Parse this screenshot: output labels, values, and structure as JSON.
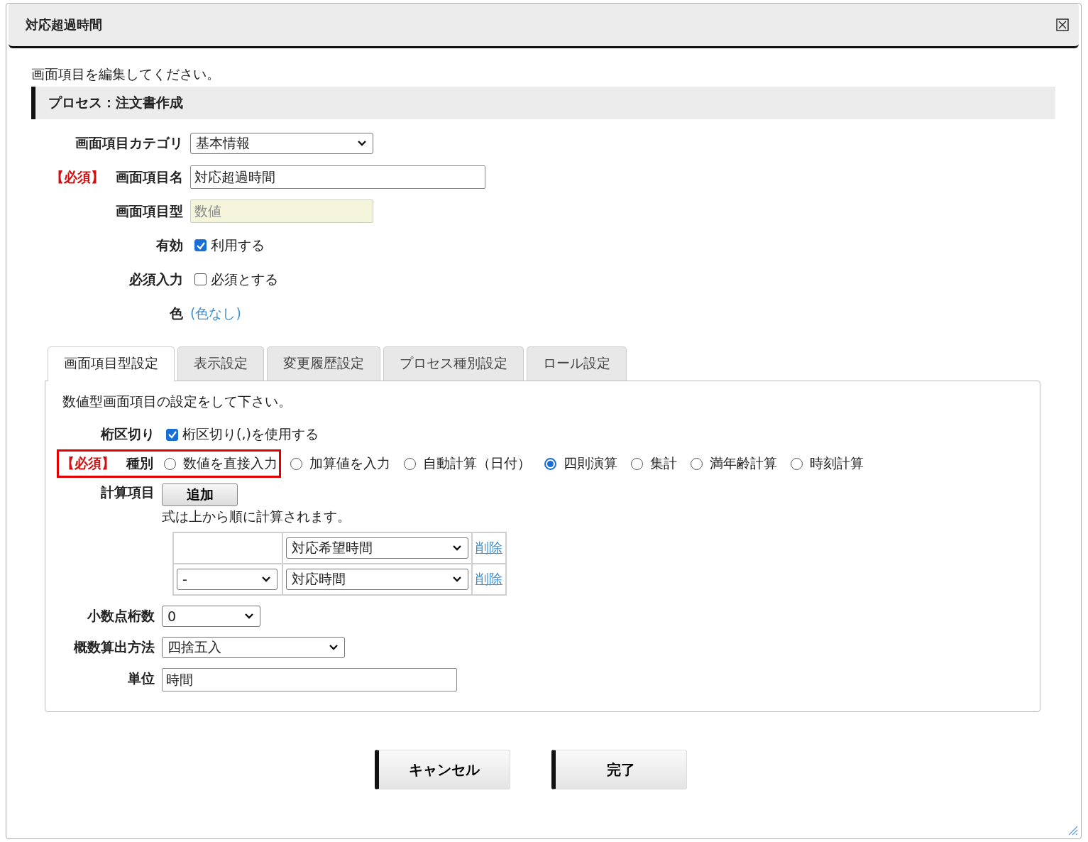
{
  "dialog": {
    "title": "対応超過時間"
  },
  "intro": "画面項目を編集してください。",
  "section": "プロセス：注文書作成",
  "fields": [
    {
      "kind": "select",
      "label": "画面項目カテゴリ",
      "value": "基本情報"
    },
    {
      "kind": "text",
      "label": "画面項目名",
      "value": "対応超過時間",
      "required_mark": "【必須】"
    },
    {
      "kind": "text",
      "label": "画面項目型",
      "value": "数値",
      "disabled": true
    },
    {
      "kind": "checkbox",
      "label": "有効",
      "text": "利用する",
      "checked": true
    },
    {
      "kind": "checkbox",
      "label": "必須入力",
      "text": "必須とする",
      "checked": false
    },
    {
      "kind": "link",
      "label": "色",
      "text": "(色なし)"
    }
  ],
  "tabs": [
    {
      "label": "画面項目型設定",
      "selected": true
    },
    {
      "label": "表示設定",
      "selected": false
    },
    {
      "label": "変更履歴設定",
      "selected": false
    },
    {
      "label": "プロセス種別設定",
      "selected": false
    },
    {
      "label": "ロール設定",
      "selected": false
    }
  ],
  "panel": {
    "description": "数値型画面項目の設定をして下さい。",
    "separator": {
      "label": "桁区切り",
      "text": "桁区切り(,)を使用する",
      "checked": true
    },
    "type": {
      "required_mark": "【必須】",
      "label": "種別",
      "highlighted": true,
      "options": [
        {
          "label": "数値を直接入力",
          "selected": false
        },
        {
          "label": "加算値を入力",
          "selected": false
        },
        {
          "label": "自動計算（日付）",
          "selected": false
        },
        {
          "label": "四則演算",
          "selected": true
        },
        {
          "label": "集計",
          "selected": false
        },
        {
          "label": "満年齢計算",
          "selected": false
        },
        {
          "label": "時刻計算",
          "selected": false
        }
      ]
    },
    "calculation": {
      "label": "計算項目",
      "button": "追加",
      "note": "式は上から順に計算されます。",
      "rows": [
        {
          "item": "対応希望時間",
          "delete": "削除"
        },
        {
          "operator": "-",
          "item": "対応時間",
          "delete": "削除"
        }
      ]
    },
    "settings": [
      {
        "kind": "select",
        "label": "小数点桁数",
        "value": "0"
      },
      {
        "kind": "select",
        "label": "概数算出方法",
        "value": "四捨五入"
      },
      {
        "kind": "text",
        "label": "単位",
        "value": "時間"
      }
    ]
  },
  "buttons": [
    {
      "label": "キャンセル"
    },
    {
      "label": "完了"
    }
  ]
}
